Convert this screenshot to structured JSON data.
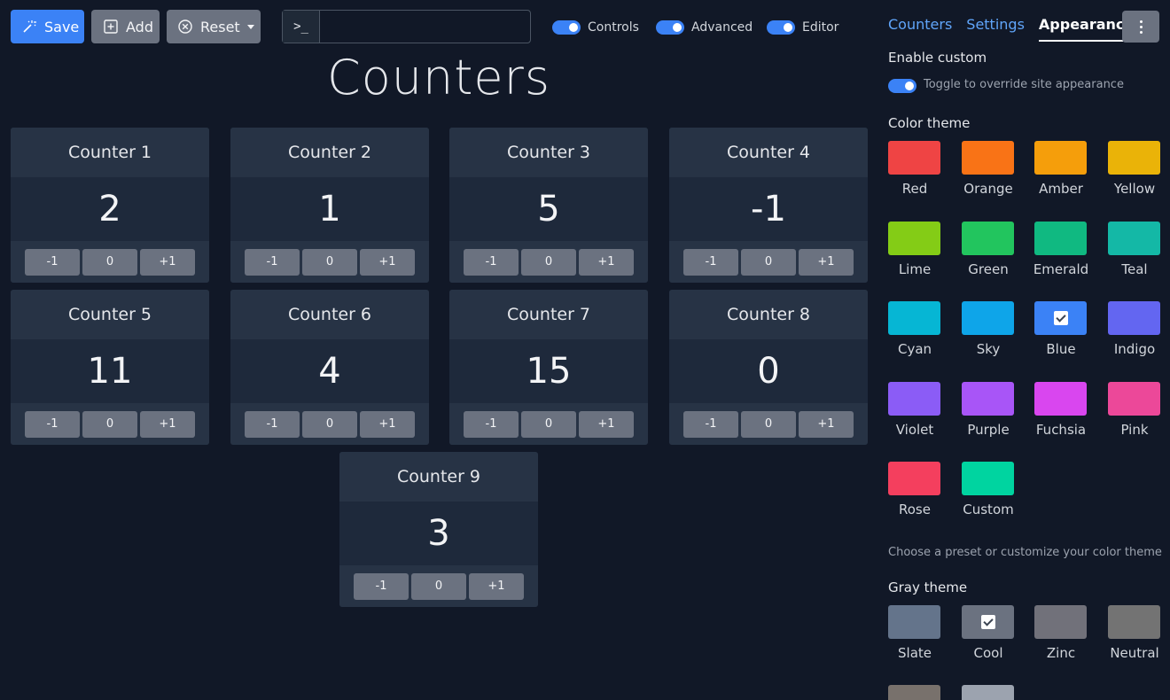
{
  "toolbar": {
    "save_label": "Save",
    "add_label": "Add",
    "reset_label": "Reset",
    "command_prefix": ">_",
    "command_value": "",
    "toggles": [
      {
        "label": "Controls",
        "on": true
      },
      {
        "label": "Advanced",
        "on": true
      },
      {
        "label": "Editor",
        "on": true
      }
    ]
  },
  "main": {
    "title": "Counters",
    "counters": [
      {
        "name": "Counter 1",
        "value": "2"
      },
      {
        "name": "Counter 2",
        "value": "1"
      },
      {
        "name": "Counter 3",
        "value": "5"
      },
      {
        "name": "Counter 4",
        "value": "-1"
      },
      {
        "name": "Counter 5",
        "value": "11"
      },
      {
        "name": "Counter 6",
        "value": "4"
      },
      {
        "name": "Counter 7",
        "value": "15"
      },
      {
        "name": "Counter 8",
        "value": "0"
      },
      {
        "name": "Counter 9",
        "value": "3"
      }
    ],
    "buttons": {
      "dec": "-1",
      "zero": "0",
      "inc": "+1"
    }
  },
  "panel": {
    "tabs": [
      {
        "label": "Counters",
        "active": false
      },
      {
        "label": "Settings",
        "active": false
      },
      {
        "label": "Appearance",
        "active": true
      }
    ],
    "enable_custom_label": "Enable custom",
    "toggle_hint": "Toggle to override site appearance",
    "color_theme_label": "Color theme",
    "color_hint": "Choose a preset or customize your color theme",
    "gray_theme_label": "Gray theme",
    "colors": [
      {
        "name": "Red",
        "hex": "#ef4444"
      },
      {
        "name": "Orange",
        "hex": "#f97316"
      },
      {
        "name": "Amber",
        "hex": "#f59e0b"
      },
      {
        "name": "Yellow",
        "hex": "#eab308"
      },
      {
        "name": "Lime",
        "hex": "#84cc16"
      },
      {
        "name": "Green",
        "hex": "#22c55e"
      },
      {
        "name": "Emerald",
        "hex": "#10b981"
      },
      {
        "name": "Teal",
        "hex": "#14b8a6"
      },
      {
        "name": "Cyan",
        "hex": "#06b6d4"
      },
      {
        "name": "Sky",
        "hex": "#0ea5e9"
      },
      {
        "name": "Blue",
        "hex": "#3b82f6",
        "selected": true
      },
      {
        "name": "Indigo",
        "hex": "#6366f1"
      },
      {
        "name": "Violet",
        "hex": "#8b5cf6"
      },
      {
        "name": "Purple",
        "hex": "#a855f7"
      },
      {
        "name": "Fuchsia",
        "hex": "#d946ef"
      },
      {
        "name": "Pink",
        "hex": "#ec4899"
      },
      {
        "name": "Rose",
        "hex": "#f43f5e"
      },
      {
        "name": "Custom",
        "hex": "#00d4a0"
      }
    ],
    "grays": [
      {
        "name": "Slate",
        "hex": "#64748b"
      },
      {
        "name": "Cool",
        "hex": "#6b7280",
        "selected": true
      },
      {
        "name": "Zinc",
        "hex": "#71717a"
      },
      {
        "name": "Neutral",
        "hex": "#737373"
      },
      {
        "name": "",
        "hex": "#78716c"
      },
      {
        "name": "",
        "hex": "#9ca3af"
      }
    ]
  }
}
